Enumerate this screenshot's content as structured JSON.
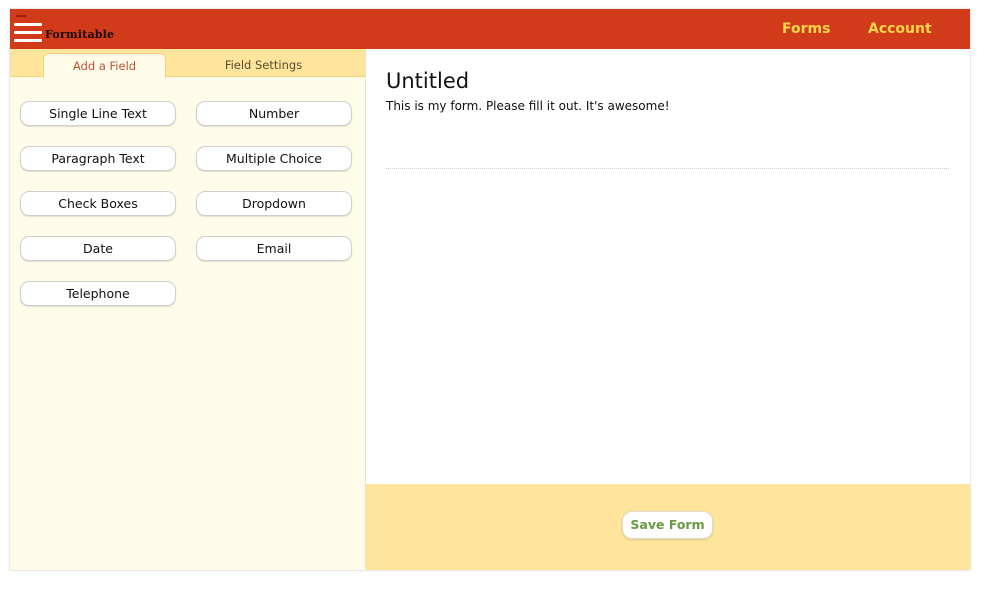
{
  "header": {
    "brand": "Formitable",
    "nav": [
      {
        "label": "Forms"
      },
      {
        "label": "Account"
      }
    ],
    "menu_icon": "hamburger-menu-icon",
    "colors": {
      "bar": "#d23b1a",
      "nav_text": "#ffd54a"
    }
  },
  "sidebar": {
    "tabs": [
      {
        "label": "Add a Field",
        "active": true
      },
      {
        "label": "Field Settings",
        "active": false
      }
    ],
    "fields": [
      {
        "label": "Single Line Text"
      },
      {
        "label": "Number"
      },
      {
        "label": "Paragraph Text"
      },
      {
        "label": "Multiple Choice"
      },
      {
        "label": "Check Boxes"
      },
      {
        "label": "Dropdown"
      },
      {
        "label": "Date"
      },
      {
        "label": "Email"
      },
      {
        "label": "Telephone"
      }
    ]
  },
  "form": {
    "title": "Untitled",
    "description": "This is my form. Please fill it out. It's awesome!"
  },
  "footer": {
    "save_label": "Save Form"
  }
}
